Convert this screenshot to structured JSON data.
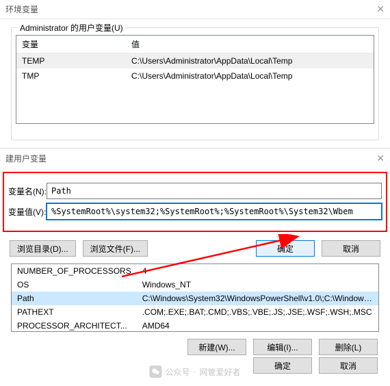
{
  "parent_dialog": {
    "title": "环境变量",
    "group_title": "Administrator 的用户变量(U)",
    "columns": {
      "var": "变量",
      "val": "值"
    },
    "rows": [
      {
        "name": "TEMP",
        "value": "C:\\Users\\Administrator\\AppData\\Local\\Temp",
        "selected": true
      },
      {
        "name": "TMP",
        "value": "C:\\Users\\Administrator\\AppData\\Local\\Temp",
        "selected": false
      }
    ]
  },
  "edit_dialog": {
    "title": "建用户变量",
    "name_label": "变量名(N):",
    "value_label": "变量值(V):",
    "name_value": "Path",
    "value_value": "%SystemRoot%\\system32;%SystemRoot%;%SystemRoot%\\System32\\Wbem",
    "browse_dir": "浏览目录(D)...",
    "browse_file": "浏览文件(F)...",
    "ok": "确定",
    "cancel": "取消"
  },
  "sys_vars": {
    "rows": [
      {
        "name": "NUMBER_OF_PROCESSORS",
        "value": "4"
      },
      {
        "name": "OS",
        "value": "Windows_NT"
      },
      {
        "name": "Path",
        "value": "C:\\Windows\\System32\\WindowsPowerShell\\v1.0\\;C:\\Windows...",
        "highlight": true
      },
      {
        "name": "PATHEXT",
        "value": ".COM;.EXE;.BAT;.CMD;.VBS;.VBE;.JS;.JSE;.WSF;.WSH;.MSC"
      },
      {
        "name": "PROCESSOR_ARCHITECT...",
        "value": "AMD64"
      }
    ],
    "new": "新建(W)...",
    "edit": "编辑(I)...",
    "delete": "删除(L)"
  },
  "footer": {
    "ok": "确定",
    "cancel": "取消"
  },
  "watermark": {
    "prefix": "公众号",
    "sep": "·",
    "name": "网管爱好者"
  }
}
